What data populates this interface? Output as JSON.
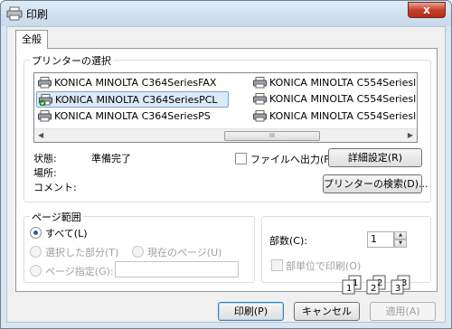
{
  "window": {
    "title": "印刷",
    "close_label": "x"
  },
  "tabs": [
    {
      "label": "全般",
      "selected": true
    }
  ],
  "printer_section": {
    "label": "プリンターの選択",
    "printers": [
      {
        "name": "KONICA MINOLTA C364SeriesFAX",
        "icon": "fax-printer-icon",
        "selected": false
      },
      {
        "name": "KONICA MINOLTA C364SeriesPCL",
        "icon": "default-printer-icon",
        "selected": true
      },
      {
        "name": "KONICA MINOLTA C364SeriesPS",
        "icon": "printer-icon",
        "selected": false
      },
      {
        "name": "KONICA MINOLTA C554Seriesl",
        "icon": "printer-icon",
        "selected": false
      },
      {
        "name": "KONICA MINOLTA C554Seriesl",
        "icon": "printer-icon",
        "selected": false
      },
      {
        "name": "KONICA MINOLTA C554Seriesl",
        "icon": "printer-icon",
        "selected": false
      }
    ],
    "scroll_thumb_grip": "III",
    "status_label": "状態:",
    "status_value": "準備完了",
    "location_label": "場所:",
    "comment_label": "コメント:",
    "print_to_file_label": "ファイルへ出力(F)",
    "print_to_file_checked": false,
    "preferences_button": "詳細設定(R)",
    "find_printer_button": "プリンターの検索(D)..."
  },
  "page_range": {
    "label": "ページ範囲",
    "options": [
      {
        "label": "すべて(L)",
        "checked": true,
        "enabled": true
      },
      {
        "label": "選択した部分(T)",
        "checked": false,
        "enabled": false
      },
      {
        "label": "現在のページ(U)",
        "checked": false,
        "enabled": false
      },
      {
        "label": "ページ指定(G):",
        "checked": false,
        "enabled": false
      }
    ],
    "pages_value": ""
  },
  "copies": {
    "label": "部数(C):",
    "value": "1",
    "collate_label": "部単位で印刷(O)",
    "collate_checked": false,
    "collate_enabled": false,
    "collate_pages": [
      "1",
      "1",
      "2",
      "2",
      "3",
      "3"
    ]
  },
  "footer": {
    "print_button": "印刷(P)",
    "cancel_button": "キャンセル",
    "apply_button": "適用(A)"
  },
  "colors": {
    "frame": "#d9e6f2",
    "close": "#c8402b",
    "selection": "#dceaf7",
    "disabled_text": "#a0a0a0"
  }
}
